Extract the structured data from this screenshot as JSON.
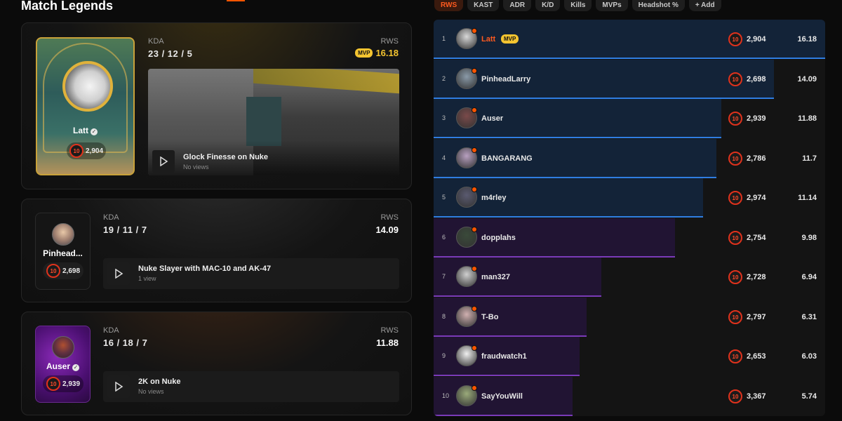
{
  "heading": "Match Legends",
  "cards": [
    {
      "player": "Latt",
      "elo": "2,904",
      "level": "10",
      "kda_label": "KDA",
      "kda": "23 / 12 / 5",
      "rws_label": "RWS",
      "mvp": "MVP",
      "rws": "16.18",
      "video_title": "Glock Finesse on Nuke",
      "video_views": "No views"
    },
    {
      "player": "Pinhead...",
      "elo": "2,698",
      "level": "10",
      "kda_label": "KDA",
      "kda": "19 / 11 / 7",
      "rws_label": "RWS",
      "rws": "14.09",
      "video_title": "Nuke Slayer with MAC-10 and AK-47",
      "video_views": "1 view"
    },
    {
      "player": "Auser",
      "elo": "2,939",
      "level": "10",
      "kda_label": "KDA",
      "kda": "16 / 18 / 7",
      "rws_label": "RWS",
      "rws": "11.88",
      "video_title": "2K on Nuke",
      "video_views": "No views"
    }
  ],
  "tabs": [
    "RWS",
    "KAST",
    "ADR",
    "K/D",
    "Kills",
    "MVPs",
    "Headshot %",
    "+ Add"
  ],
  "active_tab": "RWS",
  "colors": {
    "accent": "#ff5500",
    "team_a": "#2f7de1",
    "team_b": "#7a3ab8",
    "mvp": "#f4c430"
  },
  "leaderboard": [
    {
      "rank": "1",
      "name": "Latt",
      "mvp": "MVP",
      "level": "10",
      "elo": "2,904",
      "rws": "16.18",
      "team": "blue",
      "fill": 1.0
    },
    {
      "rank": "2",
      "name": "PinheadLarry",
      "level": "10",
      "elo": "2,698",
      "rws": "14.09",
      "team": "blue",
      "fill": 0.87
    },
    {
      "rank": "3",
      "name": "Auser",
      "level": "10",
      "elo": "2,939",
      "rws": "11.88",
      "team": "blue",
      "fill": 0.734
    },
    {
      "rank": "4",
      "name": "BANGARANG",
      "level": "10",
      "elo": "2,786",
      "rws": "11.7",
      "team": "blue",
      "fill": 0.723
    },
    {
      "rank": "5",
      "name": "m4rley",
      "level": "10",
      "elo": "2,974",
      "rws": "11.14",
      "team": "blue",
      "fill": 0.688
    },
    {
      "rank": "6",
      "name": "dopplahs",
      "level": "10",
      "elo": "2,754",
      "rws": "9.98",
      "team": "purple",
      "fill": 0.617
    },
    {
      "rank": "7",
      "name": "man327",
      "level": "10",
      "elo": "2,728",
      "rws": "6.94",
      "team": "purple",
      "fill": 0.429
    },
    {
      "rank": "8",
      "name": "T-Bo",
      "level": "10",
      "elo": "2,797",
      "rws": "6.31",
      "team": "purple",
      "fill": 0.39
    },
    {
      "rank": "9",
      "name": "fraudwatch1",
      "level": "10",
      "elo": "2,653",
      "rws": "6.03",
      "team": "purple",
      "fill": 0.373
    },
    {
      "rank": "10",
      "name": "SayYouWill",
      "level": "10",
      "elo": "3,367",
      "rws": "5.74",
      "team": "purple",
      "fill": 0.355
    }
  ]
}
